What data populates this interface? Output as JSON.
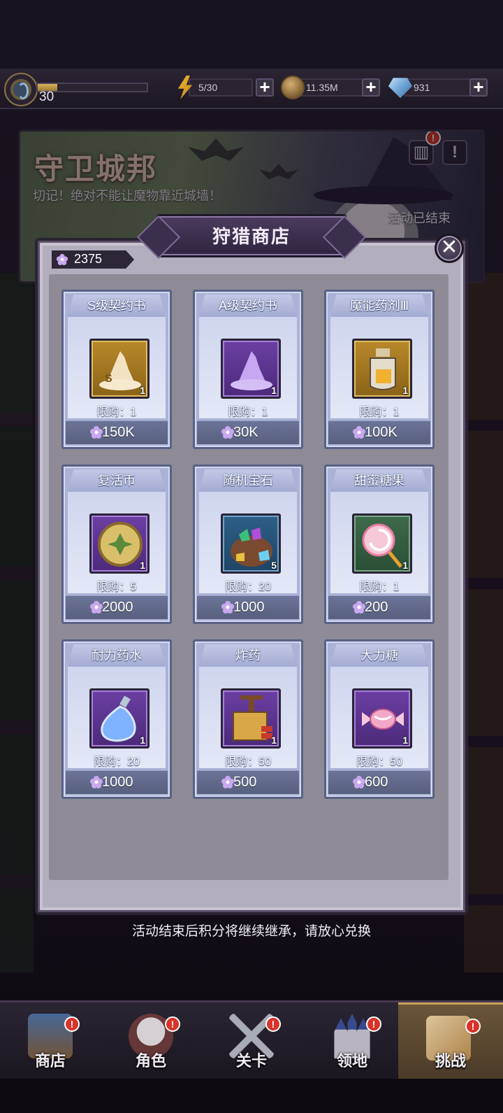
{
  "status_bar": {
    "level": "30",
    "xp_progress": 0.18,
    "energy": "5/30",
    "coins": "11.35M",
    "gems": "931",
    "plus_label": "+"
  },
  "banner": {
    "title": "守卫城邦",
    "subtitle": "切记！绝对不能让魔物靠近城墙！",
    "status": "活动已结束",
    "badge": "!"
  },
  "shop": {
    "title": "狩猎商店",
    "close_label": "✕",
    "points": "2375",
    "items": [
      {
        "name": "S级契约书",
        "qty": "1",
        "limit": "限购：1",
        "price": "150K"
      },
      {
        "name": "A级契约书",
        "qty": "1",
        "limit": "限购：1",
        "price": "30K"
      },
      {
        "name": "魔能药剂Ⅲ",
        "qty": "1",
        "limit": "限购：1",
        "price": "100K"
      },
      {
        "name": "复活币",
        "qty": "1",
        "limit": "限购：5",
        "price": "2000"
      },
      {
        "name": "随机宝石",
        "qty": "5",
        "limit": "限购：20",
        "price": "1000"
      },
      {
        "name": "甜蜜糖果",
        "qty": "1",
        "limit": "限购：1",
        "price": "200"
      },
      {
        "name": "耐力药水",
        "qty": "1",
        "limit": "限购：20",
        "price": "1000"
      },
      {
        "name": "炸药",
        "qty": "1",
        "limit": "限购：50",
        "price": "500"
      },
      {
        "name": "大力糖",
        "qty": "1",
        "limit": "限购：50",
        "price": "600"
      }
    ],
    "footer_note": "活动结束后积分将继续继承，请放心兑换"
  },
  "bottom_nav": {
    "items": [
      {
        "label": "商店",
        "badge": "!"
      },
      {
        "label": "角色",
        "badge": "!"
      },
      {
        "label": "关卡",
        "badge": "!"
      },
      {
        "label": "领地",
        "badge": "!"
      },
      {
        "label": "挑战",
        "badge": "!"
      }
    ],
    "active": "挑战"
  },
  "colors": {
    "card_body": "#aab3d6",
    "card_border": "#586286",
    "price_bar": "#58607f",
    "badge_red": "#d8332a"
  },
  "icons": {
    "currency": "purple-flower-icon",
    "energy": "lightning-icon",
    "coin": "coin-icon",
    "gem": "diamond-icon"
  }
}
